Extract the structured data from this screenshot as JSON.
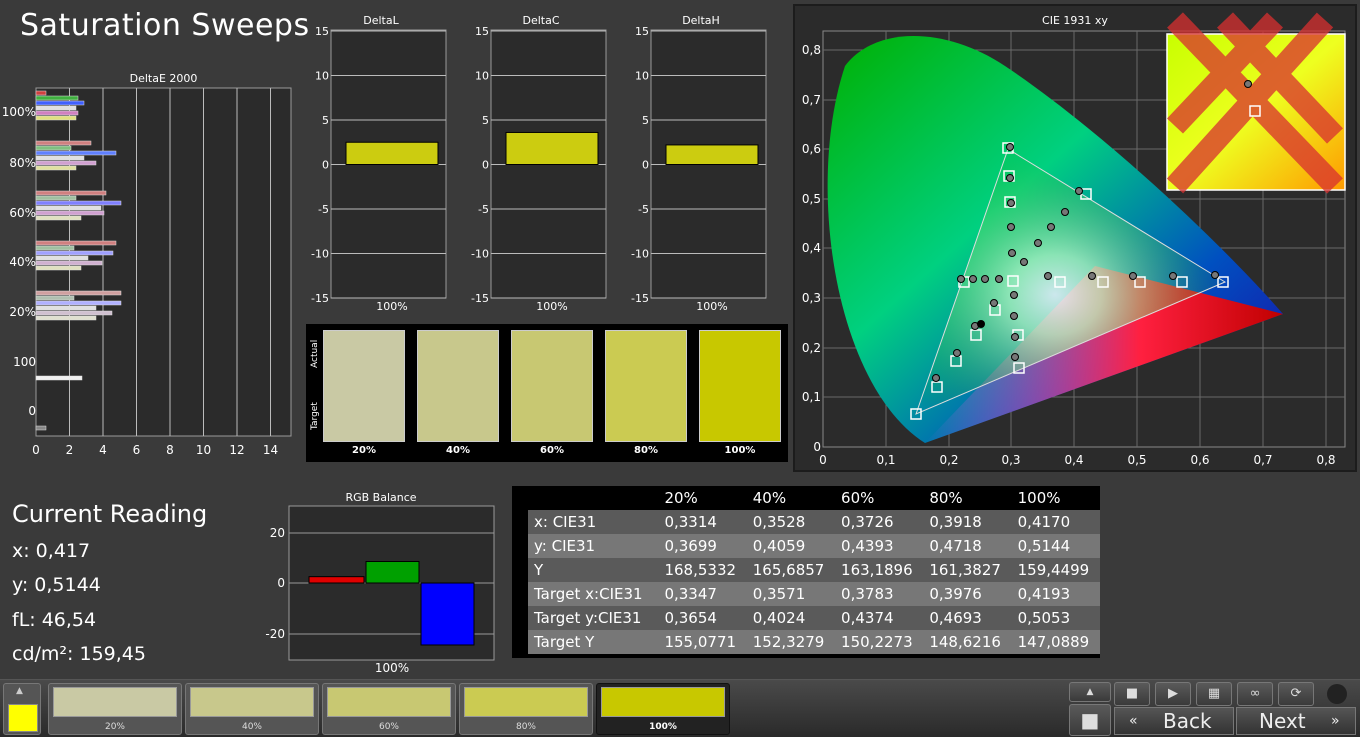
{
  "page_title": "Saturation Sweeps",
  "deltae_chart": {
    "title": "DeltaE 2000",
    "x_ticks": [
      "0",
      "2",
      "4",
      "6",
      "8",
      "10",
      "12",
      "14"
    ],
    "y_labels": [
      "100%",
      "80%",
      "60%",
      "40%",
      "20%",
      "100",
      "0"
    ]
  },
  "delta_charts": [
    {
      "title": "DeltaL",
      "category": "100%",
      "value": 2.5
    },
    {
      "title": "DeltaC",
      "category": "100%",
      "value": 3.6
    },
    {
      "title": "DeltaH",
      "category": "100%",
      "value": 2.2
    }
  ],
  "delta_y_ticks": [
    "15",
    "10",
    "5",
    "0",
    "-5",
    "-10",
    "-15"
  ],
  "swatches": {
    "actual_label": "Actual",
    "target_label": "Target",
    "items": [
      {
        "label": "20%",
        "actual": "#c9c9a4",
        "target": "#c9c9a4"
      },
      {
        "label": "40%",
        "actual": "#c8c88c",
        "target": "#c8c88c"
      },
      {
        "label": "60%",
        "actual": "#c8c872",
        "target": "#c8c872"
      },
      {
        "label": "80%",
        "actual": "#cbcb52",
        "target": "#cbcb52"
      },
      {
        "label": "100%",
        "actual": "#c8c800",
        "target": "#c8c800"
      }
    ]
  },
  "cie_chart": {
    "title": "CIE 1931 xy",
    "x_ticks": [
      "0",
      "0,1",
      "0,2",
      "0,3",
      "0,4",
      "0,5",
      "0,6",
      "0,7",
      "0,8"
    ],
    "y_ticks": [
      "0",
      "0,1",
      "0,2",
      "0,3",
      "0,4",
      "0,5",
      "0,6",
      "0,7",
      "0,8"
    ]
  },
  "current_reading": {
    "heading": "Current Reading",
    "x": "x: 0,417",
    "y": "y: 0,5144",
    "fl": "fL: 46,54",
    "cdm2": "cd/m²: 159,45"
  },
  "rgb_balance": {
    "title": "RGB Balance",
    "y_ticks": [
      "20",
      "0",
      "-20"
    ],
    "category": "100%",
    "values": {
      "red": 2.5,
      "green": 8.5,
      "blue": -24.5
    },
    "colors": {
      "red": "#e00000",
      "green": "#00a000",
      "blue": "#0000ff"
    }
  },
  "table": {
    "headers": [
      "",
      "20%",
      "40%",
      "60%",
      "80%",
      "100%"
    ],
    "rows": [
      [
        "x: CIE31",
        "0,3314",
        "0,3528",
        "0,3726",
        "0,3918",
        "0,4170"
      ],
      [
        "y: CIE31",
        "0,3699",
        "0,4059",
        "0,4393",
        "0,4718",
        "0,5144"
      ],
      [
        "Y",
        "168,5332",
        "165,6857",
        "163,1896",
        "161,3827",
        "159,4499"
      ],
      [
        "Target x:CIE31",
        "0,3347",
        "0,3571",
        "0,3783",
        "0,3976",
        "0,4193"
      ],
      [
        "Target y:CIE31",
        "0,3654",
        "0,4024",
        "0,4374",
        "0,4693",
        "0,5053"
      ],
      [
        "Target Y",
        "155,0771",
        "152,3279",
        "150,2273",
        "148,6216",
        "147,0889"
      ]
    ]
  },
  "bottom_tiles": [
    {
      "label": "20%",
      "color": "#c9c9a4"
    },
    {
      "label": "40%",
      "color": "#c8c88c"
    },
    {
      "label": "60%",
      "color": "#c8c872"
    },
    {
      "label": "80%",
      "color": "#cbcb52"
    },
    {
      "label": "100%",
      "color": "#c8c800"
    }
  ],
  "nav": {
    "back": "Back",
    "next": "Next"
  },
  "current_color": "#ffff00"
}
